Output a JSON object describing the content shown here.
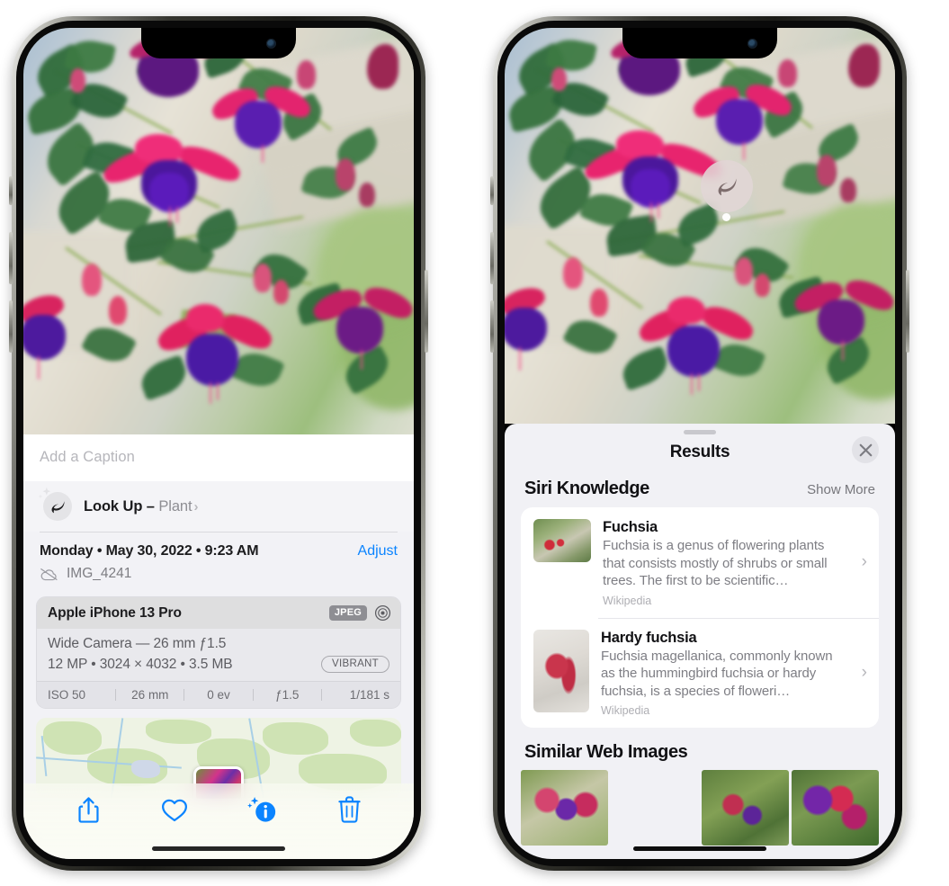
{
  "left_phone": {
    "caption": {
      "placeholder": "Add a Caption"
    },
    "lookup": {
      "title": "Look Up",
      "dash": "–",
      "subject": "Plant",
      "chevron": "›",
      "icon": "leaf-icon"
    },
    "date": {
      "text": "Monday • May 30, 2022 • 9:23 AM",
      "adjust_label": "Adjust"
    },
    "file": {
      "name": "IMG_4241",
      "icon": "cloud-slash-icon"
    },
    "camera": {
      "model": "Apple iPhone 13 Pro",
      "format_chip": "JPEG",
      "aperture_icon": "aperture-icon",
      "lens": "Wide Camera — 26 mm ƒ1.5",
      "meta": "12 MP • 3024 × 4032 • 3.5 MB",
      "style_chip": "VIBRANT",
      "exif": [
        "ISO 50",
        "26 mm",
        "0 ev",
        "ƒ1.5",
        "1/181 s"
      ]
    },
    "toolbar": [
      {
        "name": "share-button",
        "icon": "share-icon"
      },
      {
        "name": "favorite-button",
        "icon": "heart-icon"
      },
      {
        "name": "info-button",
        "icon": "info-sparkle-icon"
      },
      {
        "name": "delete-button",
        "icon": "trash-icon"
      }
    ]
  },
  "right_phone": {
    "badge": {
      "icon": "leaf-icon"
    },
    "sheet": {
      "title": "Results",
      "close_icon": "close-icon"
    },
    "siri_knowledge": {
      "heading": "Siri Knowledge",
      "action": "Show More",
      "items": [
        {
          "title": "Fuchsia",
          "description": "Fuchsia is a genus of flowering plants that consists mostly of shrubs or small trees. The first to be scientific…",
          "source": "Wikipedia",
          "chevron": "›"
        },
        {
          "title": "Hardy fuchsia",
          "description": "Fuchsia magellanica, commonly known as the hummingbird fuchsia or hardy fuchsia, is a species of floweri…",
          "source": "Wikipedia",
          "chevron": "›"
        }
      ]
    },
    "similar_web_images": {
      "heading": "Similar Web Images",
      "count": 4
    }
  },
  "colors": {
    "accent_blue": "#0b84ff",
    "sheet_bg": "#f1f1f5",
    "card_bg": "#ffffff",
    "secondary_text": "#8e8e93",
    "primary_text": "#1c1c1e"
  }
}
